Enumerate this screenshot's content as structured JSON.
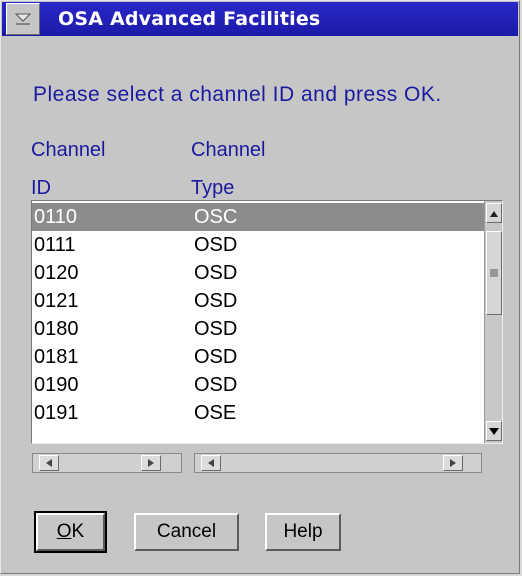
{
  "window": {
    "title": "OSA Advanced Facilities"
  },
  "prompt": "Please select a channel ID and press OK.",
  "columns": {
    "id_line1": "Channel",
    "id_line2": "ID",
    "type_line1": "Channel",
    "type_line2": "Type"
  },
  "channels": [
    {
      "id": "0110",
      "type": "OSC",
      "selected": true
    },
    {
      "id": "0111",
      "type": "OSD",
      "selected": false
    },
    {
      "id": "0120",
      "type": "OSD",
      "selected": false
    },
    {
      "id": "0121",
      "type": "OSD",
      "selected": false
    },
    {
      "id": "0180",
      "type": "OSD",
      "selected": false
    },
    {
      "id": "0181",
      "type": "OSD",
      "selected": false
    },
    {
      "id": "0190",
      "type": "OSD",
      "selected": false
    },
    {
      "id": "0191",
      "type": "OSE",
      "selected": false
    }
  ],
  "buttons": {
    "ok_label": "OK",
    "ok_mnemonic": "O",
    "ok_rest": "K",
    "cancel_label": "Cancel",
    "help_label": "Help"
  },
  "icons": {
    "system_menu": "system-menu-icon",
    "scroll_up": "arrow-up-icon",
    "scroll_down": "arrow-down-icon",
    "scroll_left": "arrow-left-icon",
    "scroll_right": "arrow-right-icon"
  },
  "colors": {
    "titlebar": "#2a28c8",
    "label_text": "#1a1aa0",
    "selection": "#8c8c8c",
    "dialog_bg": "#c6c6c6"
  }
}
